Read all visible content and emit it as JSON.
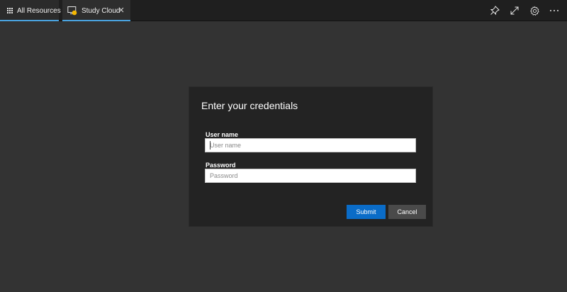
{
  "tabs": [
    {
      "label": "All Resources",
      "icon": "apps-grid-icon"
    },
    {
      "label": "Study Cloud",
      "icon": "remote-desktop-icon",
      "close_icon": "close-icon"
    }
  ],
  "toolbar": {
    "icons": [
      "pin-icon",
      "fullscreen-icon",
      "gear-icon",
      "more-icon"
    ]
  },
  "dialog": {
    "title": "Enter your credentials",
    "username_label": "User name",
    "username_placeholder": "User name",
    "username_value": "",
    "password_label": "Password",
    "password_placeholder": "Password",
    "password_value": "",
    "submit_label": "Submit",
    "cancel_label": "Cancel"
  },
  "colors": {
    "accent": "#4aa3df",
    "submit": "#0a6cc8",
    "background": "#333333",
    "dialog": "#232323",
    "badge": "#f5b700"
  }
}
